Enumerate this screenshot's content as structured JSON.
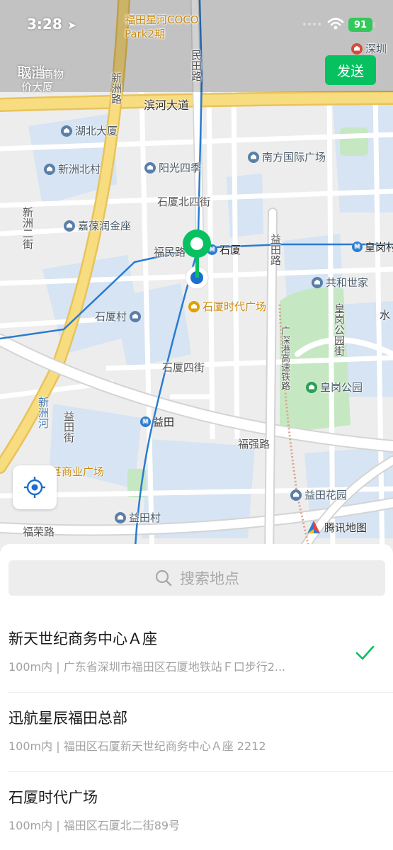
{
  "status_bar": {
    "time": "3:28",
    "battery": "91"
  },
  "header": {
    "cancel_label": "取消",
    "send_label": "发送"
  },
  "map": {
    "roads": {
      "binhe": "滨河大道",
      "mintian": "民田路",
      "xinzhou": "新洲路",
      "xinzhou2": "新洲二街",
      "fumin": "福民路",
      "shixia_n4": "石厦北四街",
      "shixia4": "石厦四街",
      "yitian_road": "益田路",
      "yitian_street": "益田街",
      "guangshen": "广深港高速铁路",
      "huanggang_park_st": "皇岗公园街",
      "fuqiang": "福强路",
      "furong": "福荣路",
      "xinzhou_river": "新洲河"
    },
    "pois": {
      "futian_price": "福田商物价大厦",
      "coco_park": "福田星河COCO Park2期",
      "shenzhen_top": "深圳",
      "hubei": "湖北大厦",
      "nanfang": "南方国际广场",
      "xinzhou_village": "新洲北村",
      "yangguang": "阳光四季",
      "jiabao": "嘉葆润金座",
      "gonghe": "共和世家",
      "shixia_village": "石厦村",
      "shixia_times": "石厦时代广场",
      "huanggang_park": "皇岗公园",
      "commerce": "甚商业广场",
      "yitian_garden": "益田花园",
      "yitian_village": "益田村",
      "shui": "水"
    },
    "metro": {
      "shixia": "石厦",
      "huanggang": "皇岗村",
      "yitian": "益田"
    },
    "attribution": "腾讯地图"
  },
  "sheet": {
    "search_placeholder": "搜索地点",
    "results": [
      {
        "title": "新天世纪商务中心Ａ座",
        "subtitle": "100m内 | 广东省深圳市福田区石厦地铁站Ｆ口步行2...",
        "selected": true
      },
      {
        "title": "迅航星辰福田总部",
        "subtitle": "100m内 | 福田区石厦新天世纪商务中心Ａ座 2212",
        "selected": false
      },
      {
        "title": "石厦时代广场",
        "subtitle": "100m内 | 福田区石厦北二街89号",
        "selected": false
      }
    ]
  },
  "colors": {
    "accent": "#07c160",
    "metro": "#2a7bd0",
    "road_major": "#f5d46b"
  }
}
